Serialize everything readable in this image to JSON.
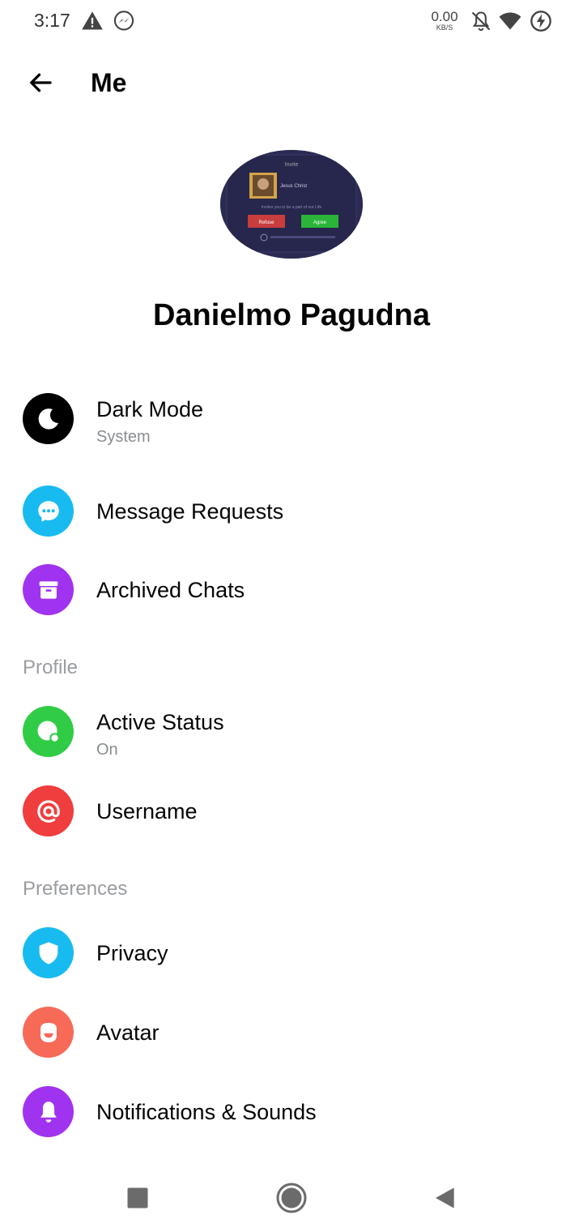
{
  "status_bar": {
    "time": "3:17",
    "net_speed_value": "0.00",
    "net_speed_unit": "KB/S",
    "icons": [
      "warning-icon",
      "messenger-icon",
      "notifications-off-icon",
      "wifi-icon",
      "battery-charging-icon"
    ]
  },
  "header": {
    "title": "Me",
    "back_icon": "arrow-left-icon"
  },
  "profile": {
    "name": "Danielmo Pagudna",
    "photo_text": {
      "top": "Invite",
      "caption": "Jesus Christ",
      "line": "Invites you to be a part of our Life",
      "refuse": "Refuse",
      "agree": "Agree"
    }
  },
  "menu_top": [
    {
      "label": "Dark Mode",
      "sub": "System",
      "icon": "moon-icon",
      "color": "#000000"
    },
    {
      "label": "Message Requests",
      "icon": "chat-bubble-icon",
      "color": "#18bbf0"
    },
    {
      "label": "Archived Chats",
      "icon": "archive-icon",
      "color": "#a033f0"
    }
  ],
  "sections": {
    "profile": "Profile",
    "preferences": "Preferences"
  },
  "menu_profile": [
    {
      "label": "Active Status",
      "sub": "On",
      "icon": "active-status-icon",
      "color": "#31cc46"
    },
    {
      "label": "Username",
      "icon": "at-sign-icon",
      "color": "#f03d3d"
    }
  ],
  "menu_preferences": [
    {
      "label": "Privacy",
      "icon": "shield-icon",
      "color": "#18bbf0"
    },
    {
      "label": "Avatar",
      "icon": "avatar-face-icon",
      "color": "#f76a58"
    },
    {
      "label": "Notifications & Sounds",
      "icon": "bell-icon",
      "color": "#a033f0"
    }
  ],
  "nav_bar": {
    "icons": [
      "recents-square-icon",
      "home-circle-icon",
      "back-triangle-icon"
    ]
  }
}
